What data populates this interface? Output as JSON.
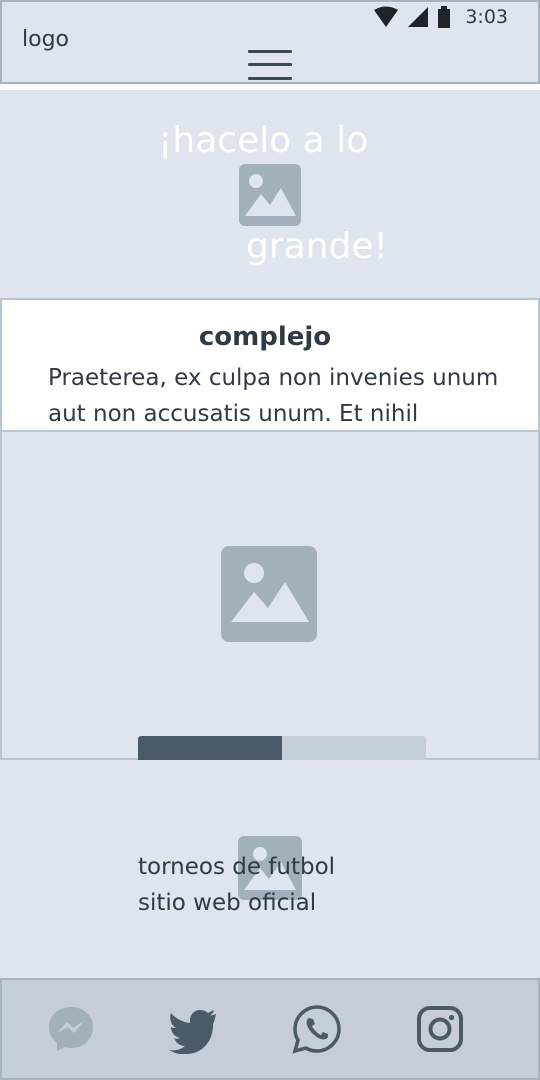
{
  "status_bar": {
    "time": "3:03",
    "icons": [
      "wifi-icon",
      "signal-icon",
      "battery-icon"
    ]
  },
  "header": {
    "logo": "logo",
    "menu_icon": "hamburger-menu-icon"
  },
  "hero": {
    "line1": "¡hacelo a lo",
    "line2": "grande!",
    "image_icon": "image-placeholder-icon"
  },
  "card": {
    "title": "complejo",
    "body": "Praeterea, ex culpa non invenies unum aut non accusatis unum. Et nihil"
  },
  "gallery": {
    "image_icon": "image-placeholder-icon",
    "progress": 0.5
  },
  "info": {
    "line1": "torneos de futbol",
    "line2": "sitio web oficial",
    "image_icon": "image-placeholder-icon"
  },
  "footer": {
    "icons": [
      "messenger-icon",
      "twitter-icon",
      "whatsapp-icon",
      "instagram-icon"
    ]
  },
  "colors": {
    "placeholder": "#a2b0bc",
    "accent": "#4b5a67",
    "footer": "#c5ced8"
  }
}
